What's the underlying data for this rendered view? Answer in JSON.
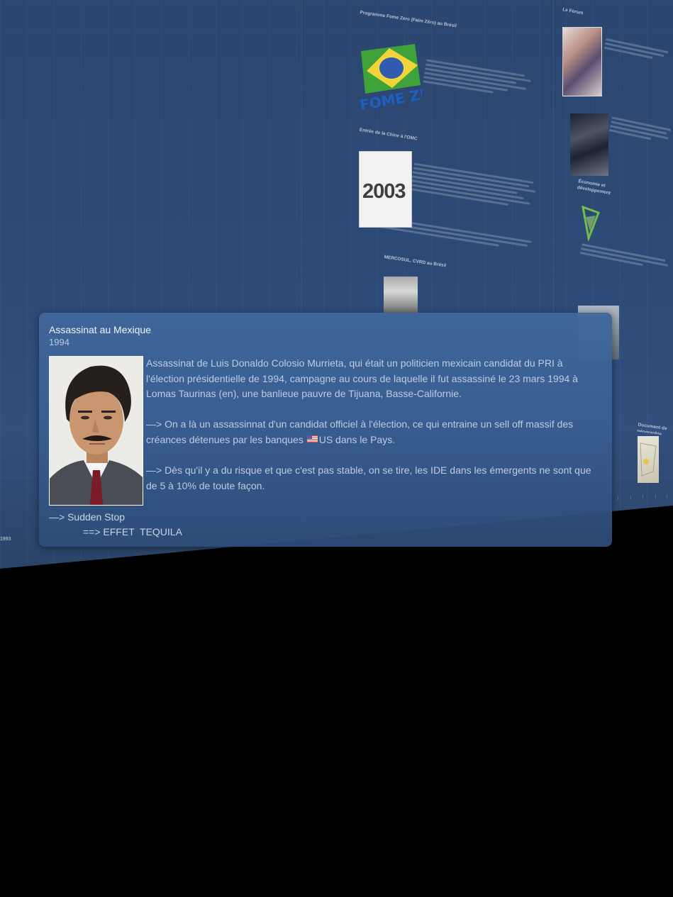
{
  "timeline_background": {
    "thumb_2003_text": "2003",
    "axis_year_label": "1993",
    "events": [
      {
        "title": "Programme Fome Zero (Faim Zéro) au Brésil"
      },
      {
        "title": "Entrée de la Chine à l'OMC"
      },
      {
        "title": "MERCOSUL, CVRD au Brésil"
      },
      {
        "title": "Le Forum"
      },
      {
        "title": "Économie et développement"
      },
      {
        "title": "Document de géographie"
      }
    ]
  },
  "popup": {
    "title": "Assassinat au Mexique",
    "year": "1994",
    "portrait_alt": "Luis Donaldo Colosio Murrieta",
    "paragraph_1": "Assassinat de Luis Donaldo Colosio Murrieta, qui était un politicien mexicain candidat du PRI à l'élection présidentielle de 1994, campagne au cours de laquelle il fut assassiné le 23 mars 1994 à Lomas Taurinas (en), une banlieue pauvre de Tijuana, Basse-Californie.",
    "paragraph_2_before_flag": "—> On a là un assassinnat d'un candidat officiel à l'élection, ce qui entraine un sell off massif des créances détenues par les banques ",
    "paragraph_2_after_flag": "US dans le Pays.",
    "paragraph_3": "—> Dès qu'il y a du risque et que c'est pas stable, on se tire, les IDE dans les émergents ne sont que de 5 à 10% de toute façon.",
    "line_sudden_stop": "—> Sudden Stop",
    "line_effet_tequila": "==> EFFET  TEQUILA"
  },
  "icons": {
    "flag": "us-flag-icon"
  },
  "colors": {
    "wall": "#2c4a76",
    "card": "#40679b",
    "card_text": "#bccce2",
    "background": "#000000"
  }
}
